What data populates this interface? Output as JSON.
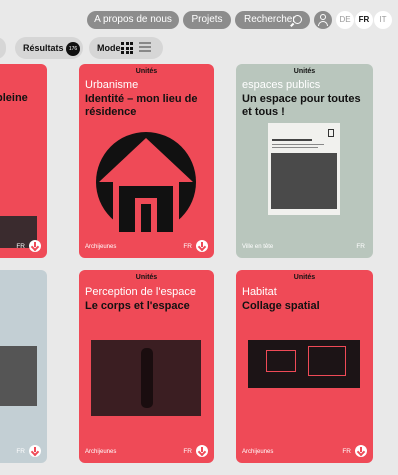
{
  "nav": {
    "about": "A propos de nous",
    "projects": "Projets",
    "search": "Rechercher",
    "languages": [
      "DE",
      "FR",
      "IT"
    ],
    "active_language": "FR"
  },
  "filters": {
    "results_label": "Résultats",
    "results_count": "176",
    "mode_label": "Mode"
  },
  "cards": [
    {
      "category": "",
      "subject": "",
      "title": "pleine",
      "author": "",
      "lang": "FR"
    },
    {
      "category": "Unités",
      "subject": "Urbanisme",
      "title": "Identité – mon lieu de résidence",
      "author": "Archijeunes",
      "lang": "FR"
    },
    {
      "category": "Unités",
      "subject": "espaces publics",
      "title": "Un espace pour toutes et tous !",
      "author": "Ville en tête",
      "lang": "FR"
    },
    {
      "category": "",
      "subject": "",
      "title": "",
      "author": "",
      "lang": "FR"
    },
    {
      "category": "Unités",
      "subject": "Perception de l'espace",
      "title": "Le corps et l'espace",
      "author": "Archijeunes",
      "lang": "FR"
    },
    {
      "category": "Unités",
      "subject": "Habitat",
      "title": "Collage spatial",
      "author": "Archijeunes",
      "lang": "FR"
    }
  ],
  "colors": {
    "accent": "#ef4a57",
    "sage": "#b9c6bd",
    "blue": "#c3cfd4",
    "background": "#e9e9e9"
  }
}
